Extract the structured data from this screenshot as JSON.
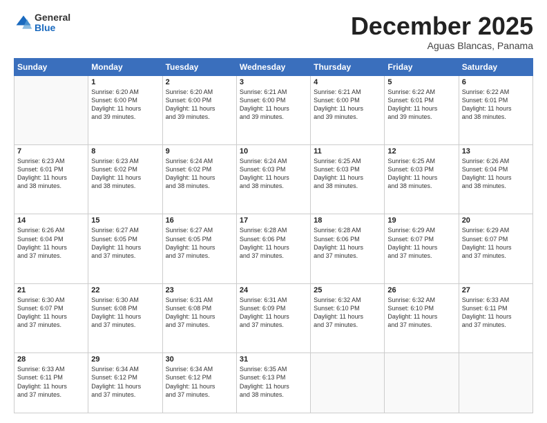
{
  "header": {
    "logo": {
      "general": "General",
      "blue": "Blue"
    },
    "title": "December 2025",
    "location": "Aguas Blancas, Panama"
  },
  "weekdays": [
    "Sunday",
    "Monday",
    "Tuesday",
    "Wednesday",
    "Thursday",
    "Friday",
    "Saturday"
  ],
  "weeks": [
    [
      {
        "day": "",
        "info": ""
      },
      {
        "day": "1",
        "info": "Sunrise: 6:20 AM\nSunset: 6:00 PM\nDaylight: 11 hours\nand 39 minutes."
      },
      {
        "day": "2",
        "info": "Sunrise: 6:20 AM\nSunset: 6:00 PM\nDaylight: 11 hours\nand 39 minutes."
      },
      {
        "day": "3",
        "info": "Sunrise: 6:21 AM\nSunset: 6:00 PM\nDaylight: 11 hours\nand 39 minutes."
      },
      {
        "day": "4",
        "info": "Sunrise: 6:21 AM\nSunset: 6:00 PM\nDaylight: 11 hours\nand 39 minutes."
      },
      {
        "day": "5",
        "info": "Sunrise: 6:22 AM\nSunset: 6:01 PM\nDaylight: 11 hours\nand 39 minutes."
      },
      {
        "day": "6",
        "info": "Sunrise: 6:22 AM\nSunset: 6:01 PM\nDaylight: 11 hours\nand 38 minutes."
      }
    ],
    [
      {
        "day": "7",
        "info": "Sunrise: 6:23 AM\nSunset: 6:01 PM\nDaylight: 11 hours\nand 38 minutes."
      },
      {
        "day": "8",
        "info": "Sunrise: 6:23 AM\nSunset: 6:02 PM\nDaylight: 11 hours\nand 38 minutes."
      },
      {
        "day": "9",
        "info": "Sunrise: 6:24 AM\nSunset: 6:02 PM\nDaylight: 11 hours\nand 38 minutes."
      },
      {
        "day": "10",
        "info": "Sunrise: 6:24 AM\nSunset: 6:03 PM\nDaylight: 11 hours\nand 38 minutes."
      },
      {
        "day": "11",
        "info": "Sunrise: 6:25 AM\nSunset: 6:03 PM\nDaylight: 11 hours\nand 38 minutes."
      },
      {
        "day": "12",
        "info": "Sunrise: 6:25 AM\nSunset: 6:03 PM\nDaylight: 11 hours\nand 38 minutes."
      },
      {
        "day": "13",
        "info": "Sunrise: 6:26 AM\nSunset: 6:04 PM\nDaylight: 11 hours\nand 38 minutes."
      }
    ],
    [
      {
        "day": "14",
        "info": "Sunrise: 6:26 AM\nSunset: 6:04 PM\nDaylight: 11 hours\nand 37 minutes."
      },
      {
        "day": "15",
        "info": "Sunrise: 6:27 AM\nSunset: 6:05 PM\nDaylight: 11 hours\nand 37 minutes."
      },
      {
        "day": "16",
        "info": "Sunrise: 6:27 AM\nSunset: 6:05 PM\nDaylight: 11 hours\nand 37 minutes."
      },
      {
        "day": "17",
        "info": "Sunrise: 6:28 AM\nSunset: 6:06 PM\nDaylight: 11 hours\nand 37 minutes."
      },
      {
        "day": "18",
        "info": "Sunrise: 6:28 AM\nSunset: 6:06 PM\nDaylight: 11 hours\nand 37 minutes."
      },
      {
        "day": "19",
        "info": "Sunrise: 6:29 AM\nSunset: 6:07 PM\nDaylight: 11 hours\nand 37 minutes."
      },
      {
        "day": "20",
        "info": "Sunrise: 6:29 AM\nSunset: 6:07 PM\nDaylight: 11 hours\nand 37 minutes."
      }
    ],
    [
      {
        "day": "21",
        "info": "Sunrise: 6:30 AM\nSunset: 6:07 PM\nDaylight: 11 hours\nand 37 minutes."
      },
      {
        "day": "22",
        "info": "Sunrise: 6:30 AM\nSunset: 6:08 PM\nDaylight: 11 hours\nand 37 minutes."
      },
      {
        "day": "23",
        "info": "Sunrise: 6:31 AM\nSunset: 6:08 PM\nDaylight: 11 hours\nand 37 minutes."
      },
      {
        "day": "24",
        "info": "Sunrise: 6:31 AM\nSunset: 6:09 PM\nDaylight: 11 hours\nand 37 minutes."
      },
      {
        "day": "25",
        "info": "Sunrise: 6:32 AM\nSunset: 6:10 PM\nDaylight: 11 hours\nand 37 minutes."
      },
      {
        "day": "26",
        "info": "Sunrise: 6:32 AM\nSunset: 6:10 PM\nDaylight: 11 hours\nand 37 minutes."
      },
      {
        "day": "27",
        "info": "Sunrise: 6:33 AM\nSunset: 6:11 PM\nDaylight: 11 hours\nand 37 minutes."
      }
    ],
    [
      {
        "day": "28",
        "info": "Sunrise: 6:33 AM\nSunset: 6:11 PM\nDaylight: 11 hours\nand 37 minutes."
      },
      {
        "day": "29",
        "info": "Sunrise: 6:34 AM\nSunset: 6:12 PM\nDaylight: 11 hours\nand 37 minutes."
      },
      {
        "day": "30",
        "info": "Sunrise: 6:34 AM\nSunset: 6:12 PM\nDaylight: 11 hours\nand 37 minutes."
      },
      {
        "day": "31",
        "info": "Sunrise: 6:35 AM\nSunset: 6:13 PM\nDaylight: 11 hours\nand 38 minutes."
      },
      {
        "day": "",
        "info": ""
      },
      {
        "day": "",
        "info": ""
      },
      {
        "day": "",
        "info": ""
      }
    ]
  ]
}
